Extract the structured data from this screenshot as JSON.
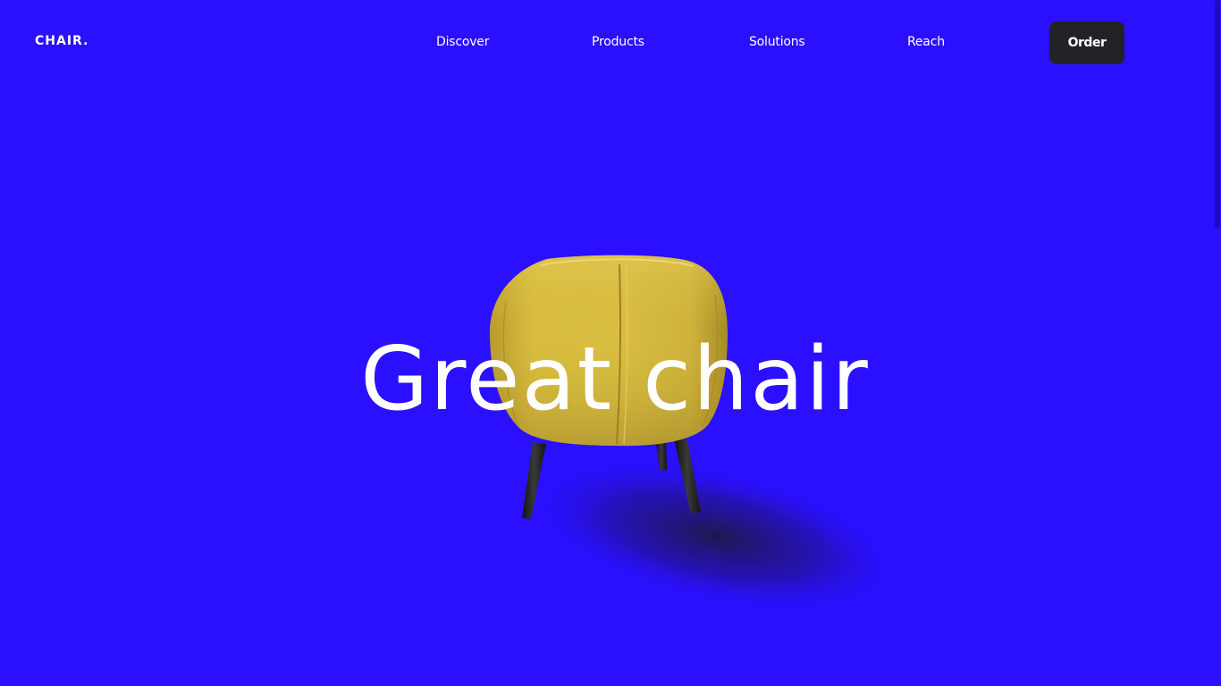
{
  "brand": {
    "logo_text": "CHAIR."
  },
  "nav": {
    "items": [
      {
        "label": "Discover"
      },
      {
        "label": "Products"
      },
      {
        "label": "Solutions"
      },
      {
        "label": "Reach"
      }
    ],
    "order_label": "Order"
  },
  "hero": {
    "title": "Great chair",
    "image": "yellow-armchair-back-view"
  },
  "colors": {
    "background": "#2a10ff",
    "button": "#232327",
    "chair": "#d8bd3e",
    "text": "#ffffff"
  }
}
